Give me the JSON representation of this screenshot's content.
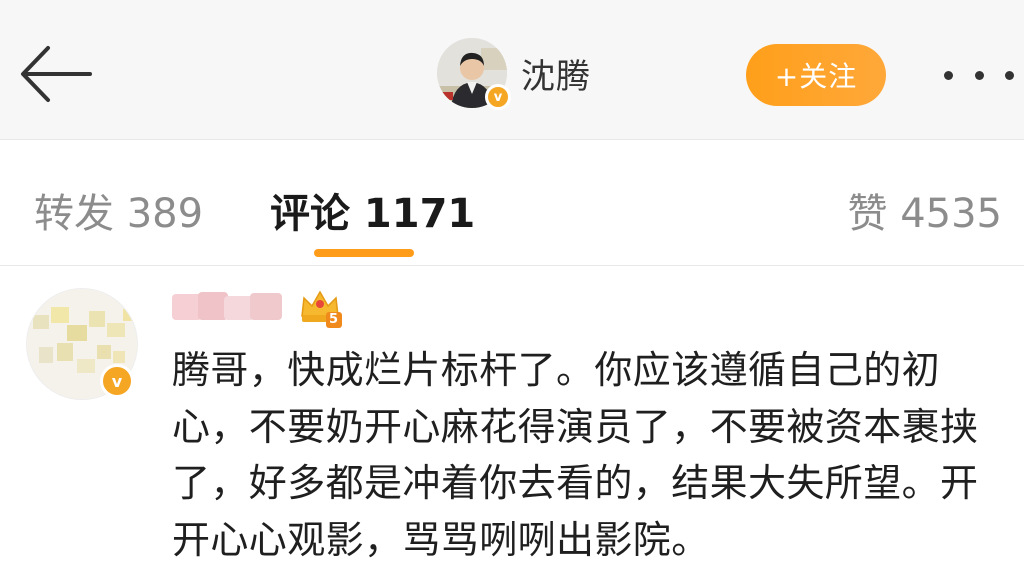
{
  "header": {
    "back_icon": "arrow-left-icon",
    "user_name": "沈腾",
    "verified_badge": "v",
    "follow_label": "+关注",
    "more_icon": "more-horizontal-icon"
  },
  "tabs": {
    "repost_label": "转发 389",
    "comments_label": "评论 1171",
    "likes_label": "赞 4535",
    "active": "comments",
    "accent_color": "#ff9c19"
  },
  "comment": {
    "author_badge": "v",
    "level_badge": "5",
    "text": "腾哥，快成烂片标杆了。你应该遵循自己的初心，不要奶开心麻花得演员了，不要被资本裹挟了，好多都是冲着你去看的，结果大失所望。开开心心观影，骂骂咧咧出影院。"
  }
}
